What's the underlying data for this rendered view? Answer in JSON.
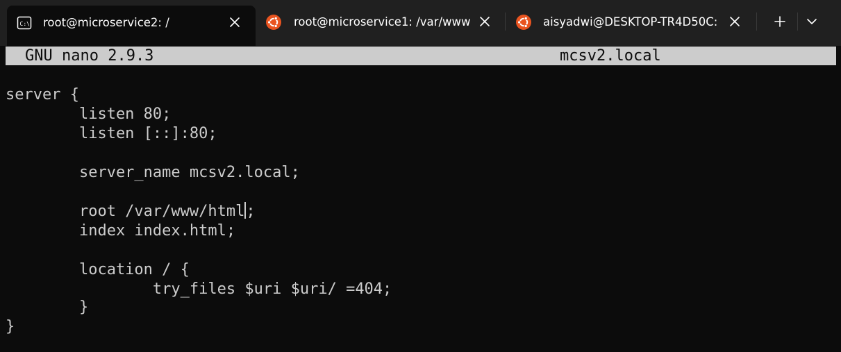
{
  "tabs": [
    {
      "title": "root@microservice2: /",
      "icon": "cmd-icon",
      "active": true
    },
    {
      "title": "root@microservice1: /var/www",
      "icon": "ubuntu-icon",
      "active": false
    },
    {
      "title": "aisyadwi@DESKTOP-TR4D50C:",
      "icon": "ubuntu-icon",
      "active": false
    }
  ],
  "toolbar": {
    "new_tab": "+",
    "dropdown": "chevron-down-icon"
  },
  "nano": {
    "version": "GNU nano 2.9.3",
    "filename": "mcsv2.local"
  },
  "file": {
    "lines": [
      "",
      "server {",
      "        listen 80;",
      "        listen [::]:80;",
      "",
      "        server_name mcsv2.local;",
      "",
      "        root /var/www/html",
      "        index index.html;",
      "",
      "        location / {",
      "                try_files $uri $uri/ =404;",
      "        }",
      "}"
    ],
    "cursor_after": ";"
  },
  "colors": {
    "terminal_bg": "#0c0c0c",
    "tabbar_bg": "#202020",
    "text": "#cccccc",
    "header_bg": "#cccccc",
    "ubuntu_orange": "#e95420"
  }
}
